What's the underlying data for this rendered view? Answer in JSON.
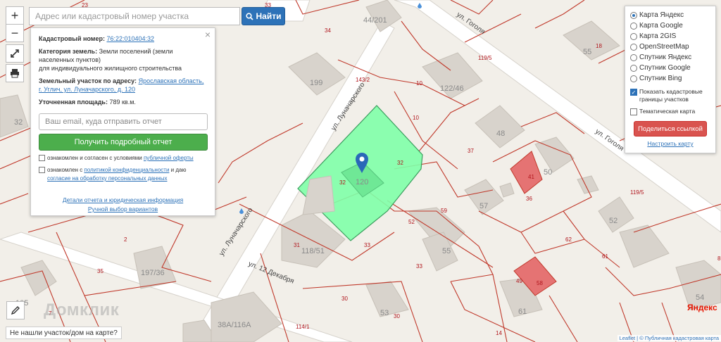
{
  "map": {
    "parcel_number": "120",
    "neighbor_numbers": [
      "199",
      "44/201",
      "122/46",
      "48",
      "55",
      "57",
      "52",
      "50",
      "41",
      "118/51",
      "55",
      "197/36",
      "53",
      "61",
      "38А/116А",
      "54",
      "105",
      "32"
    ],
    "parcel_labels": [
      "34",
      "33",
      "23",
      "143/2",
      "10",
      "10",
      "119/5",
      "18",
      "37",
      "32",
      "32",
      "36",
      "119/5",
      "59",
      "52",
      "62",
      "61",
      "31",
      "33",
      "33",
      "2",
      "35",
      "7",
      "30",
      "30",
      "114/1",
      "14",
      "49",
      "58",
      "8"
    ],
    "streets": [
      "ул. Гоголя",
      "ул. Гоголя",
      "ул. Луначарского",
      "ул. Луначарского",
      "ул. 12 Декабря"
    ],
    "colors": {
      "highlight": "#7fffa8",
      "boundary": "#c0392b",
      "road": "#ffffff",
      "building": "#d8d3cc",
      "red_building": "#e57373"
    }
  },
  "controls": {
    "zoom_in": "+",
    "zoom_out": "−",
    "fullscreen_icon": "expand-icon",
    "print_icon": "print-icon"
  },
  "search": {
    "placeholder": "Адрес или кадастровый номер участка",
    "button_label": "Найти"
  },
  "info": {
    "cadastral_label": "Кадастровый номер:",
    "cadastral_value": "76:22:010404:32",
    "category_label": "Категория земель:",
    "category_value": "Земли поселений (земли населенных пунктов)",
    "category_purpose": "для индивидуального жилищного строительства",
    "address_label": "Земельный участок по адресу:",
    "address_value": "Ярославская область, г. Углич, ул. Луначарского, д. 120",
    "area_label": "Уточненная площадь:",
    "area_value": "789 кв.м.",
    "email_placeholder": "Ваш email, куда отправить отчет",
    "report_button": "Получить подробный отчет",
    "consent1_prefix": "ознакомлен и согласен с условиями ",
    "consent1_link": "публичной оферты",
    "consent2_prefix": "ознакомлен с ",
    "consent2_link": "политикой конфиденциальности",
    "consent2_mid": " и даю",
    "consent2_link2": "согласие на обработку персональных данных",
    "link_details": "Детали отчета и юридическая информация",
    "link_manual": "Ручной выбор вариантов",
    "close": "×"
  },
  "layers": {
    "options": [
      "Карта Яндекс",
      "Карта Google",
      "Карта 2GIS",
      "OpenStreetMap",
      "Спутник Яндекс",
      "Спутник Google",
      "Спутник Bing"
    ],
    "selected": 0,
    "show_boundaries": "Показать кадастровые границы участков",
    "thematic": "Тематическая карта",
    "share_button": "Поделиться ссылкой",
    "setup_link": "Настроить карту"
  },
  "bottom": {
    "not_found": "Не нашли участок/дом на карте?",
    "watermark": "Домклик",
    "yandex": "Яндекс",
    "attrib_leaflet": "Leaflet",
    "attrib_rest": " | © Публичная кадастровая карта"
  }
}
